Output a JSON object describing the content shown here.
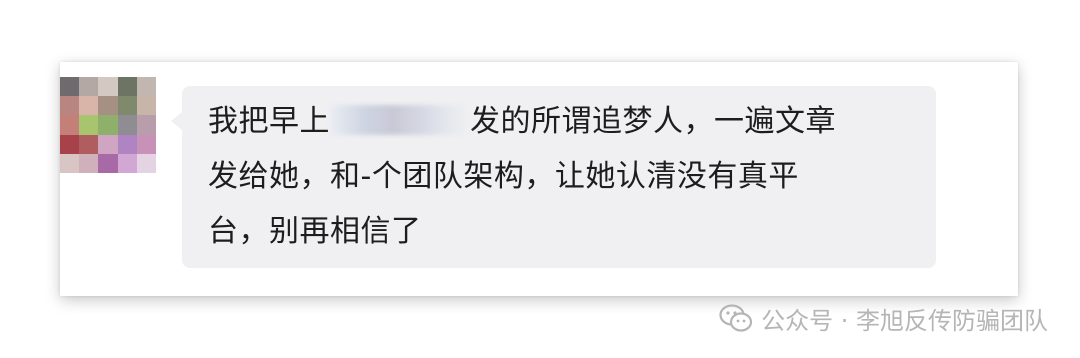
{
  "message": {
    "line1_before": "我把早上",
    "line1_after": "发的所谓追梦人，一遍文章",
    "line2": "发给她，和-个团队架构，让她认清没有真平",
    "line3": "台，别再相信了"
  },
  "icons": {
    "avatar": "avatar-pixelated",
    "watermark": "wechat-icon"
  },
  "watermark": {
    "text": "公众号 · 李旭反传防骗团队"
  },
  "colors": {
    "bubble_bg": "#f0f0f2",
    "text": "#1d1d1d",
    "watermark": "#b5b5b5"
  }
}
